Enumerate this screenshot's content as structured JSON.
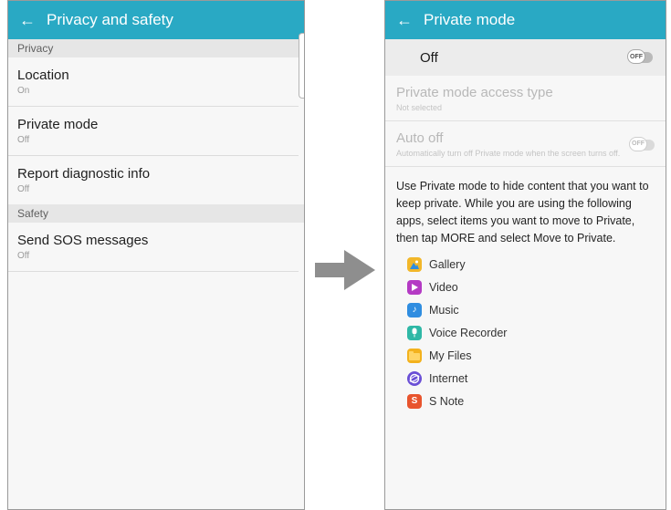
{
  "left": {
    "title": "Privacy and safety",
    "sections": [
      {
        "header": "Privacy",
        "items": [
          {
            "title": "Location",
            "sub": "On"
          },
          {
            "title": "Private mode",
            "sub": "Off"
          },
          {
            "title": "Report diagnostic info",
            "sub": "Off"
          }
        ]
      },
      {
        "header": "Safety",
        "items": [
          {
            "title": "Send SOS messages",
            "sub": "Off"
          }
        ]
      }
    ]
  },
  "right": {
    "title": "Private mode",
    "master": {
      "label": "Off",
      "toggle_text": "OFF"
    },
    "access": {
      "title": "Private mode access type",
      "sub": "Not selected"
    },
    "auto_off": {
      "title": "Auto off",
      "sub": "Automatically turn off Private mode when the screen turns off.",
      "toggle_text": "OFF"
    },
    "description": "Use Private mode to hide content that you want to keep private. While you are using the following apps, select items you want to move to Private, then tap MORE and select Move to Private.",
    "apps": [
      {
        "label": "Gallery",
        "icon": "gallery-icon",
        "color": "#f2b72a"
      },
      {
        "label": "Video",
        "icon": "video-icon",
        "color": "#b43ac4"
      },
      {
        "label": "Music",
        "icon": "music-icon",
        "color": "#2f8de0"
      },
      {
        "label": "Voice Recorder",
        "icon": "voice-recorder-icon",
        "color": "#2fb8a6"
      },
      {
        "label": "My Files",
        "icon": "my-files-icon",
        "color": "#f3b21d"
      },
      {
        "label": "Internet",
        "icon": "internet-icon",
        "color": "#6a4fd6"
      },
      {
        "label": "S Note",
        "icon": "s-note-icon",
        "color": "#e8542d"
      }
    ]
  },
  "colors": {
    "appbar": "#29a9c4",
    "arrow": "#8e8e8e"
  }
}
